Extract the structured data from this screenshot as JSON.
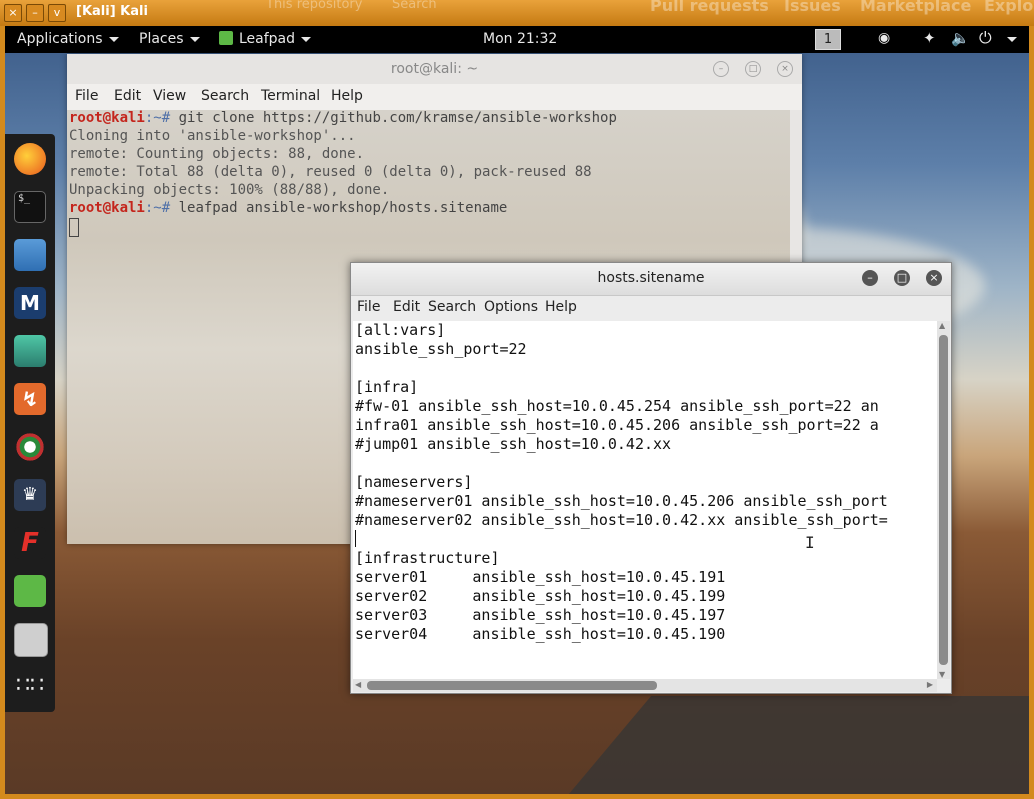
{
  "vm": {
    "title": "[Kali] Kali",
    "buttons": [
      "×",
      "–",
      "v"
    ],
    "background_texts": [
      "This repository",
      "Search",
      "Pull requests",
      "Issues",
      "Marketplace",
      "Explo"
    ]
  },
  "top_panel": {
    "applications": "Applications",
    "places": "Places",
    "leafpad": "Leafpad",
    "clock": "Mon 21:32",
    "workspace": "1"
  },
  "dock": {
    "items": [
      "firefox-icon",
      "terminal-icon",
      "files-icon",
      "metasploit-icon",
      "armitage-icon",
      "burpsuite-icon",
      "maltego-icon",
      "beef-icon",
      "faraday-icon",
      "leafpad-icon",
      "screenshot-icon",
      "show-apps-icon"
    ]
  },
  "terminal": {
    "title": "root@kali: ~",
    "menu": [
      "File",
      "Edit",
      "View",
      "Search",
      "Terminal",
      "Help"
    ],
    "prompt_user": "root@kali",
    "prompt_path": ":~#",
    "cmd1": " git clone https://github.com/kramse/ansible-workshop",
    "out1": "Cloning into 'ansible-workshop'...",
    "out2": "remote: Counting objects: 88, done.",
    "out3": "remote: Total 88 (delta 0), reused 0 (delta 0), pack-reused 88",
    "out4": "Unpacking objects: 100% (88/88), done.",
    "cmd2": " leafpad ansible-workshop/hosts.sitename"
  },
  "leafpad": {
    "title": "hosts.sitename",
    "menu": [
      "File",
      "Edit",
      "Search",
      "Options",
      "Help"
    ],
    "lines": [
      "[all:vars]",
      "ansible_ssh_port=22",
      "",
      "[infra]",
      "#fw-01 ansible_ssh_host=10.0.45.254 ansible_ssh_port=22 an",
      "infra01 ansible_ssh_host=10.0.45.206 ansible_ssh_port=22 a",
      "#jump01 ansible_ssh_host=10.0.42.xx",
      "",
      "[nameservers]",
      "#nameserver01 ansible_ssh_host=10.0.45.206 ansible_ssh_port",
      "#nameserver02 ansible_ssh_host=10.0.42.xx ansible_ssh_port=",
      "",
      "[infrastructure]",
      "server01     ansible_ssh_host=10.0.45.191",
      "server02     ansible_ssh_host=10.0.45.199",
      "server03     ansible_ssh_host=10.0.45.197",
      "server04     ansible_ssh_host=10.0.45.190"
    ]
  }
}
